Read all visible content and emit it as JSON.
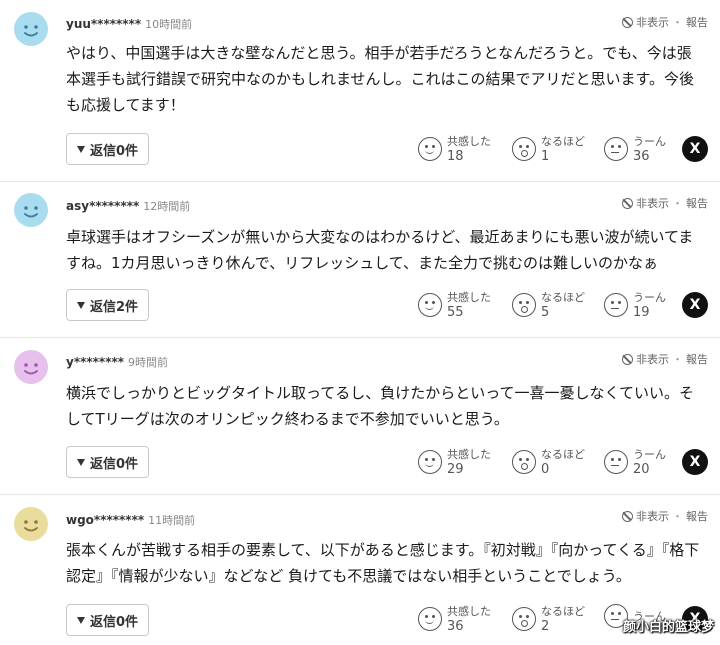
{
  "options": {
    "hide": "非表示",
    "sep": "・",
    "report": "報告"
  },
  "reactions": {
    "agree": "共感した",
    "insight": "なるほど",
    "hmm": "うーん"
  },
  "share_label": "X",
  "colors": {
    "avatar_blue": "#a9dcef",
    "avatar_pink": "#e8c0ee",
    "avatar_yellow": "#e9dc9c"
  },
  "comments": [
    {
      "user": "yuu********",
      "time": "10時間前",
      "body": "やはり、中国選手は大きな壁なんだと思う。相手が若手だろうとなんだろうと。でも、今は張本選手も試行錯誤で研究中なのかもしれませんし。これはこの結果でアリだと思います。今後も応援してます！",
      "reply_label": "返信0件",
      "agree": "18",
      "insight": "1",
      "hmm": "36"
    },
    {
      "user": "asy********",
      "time": "12時間前",
      "body": "卓球選手はオフシーズンが無いから大変なのはわかるけど、最近あまりにも悪い波が続いてますね。1カ月思いっきり休んで、リフレッシュして、また全力で挑むのは難しいのかなぁ",
      "reply_label": "返信2件",
      "agree": "55",
      "insight": "5",
      "hmm": "19"
    },
    {
      "user": "y********",
      "time": "9時間前",
      "body": "横浜でしっかりとビッグタイトル取ってるし、負けたからといって一喜一憂しなくていい。そしてTリーグは次のオリンピック終わるまで不参加でいいと思う。",
      "reply_label": "返信0件",
      "agree": "29",
      "insight": "0",
      "hmm": "20"
    },
    {
      "user": "wgo********",
      "time": "11時間前",
      "body": "張本くんが苦戦する相手の要素して、以下があると感じます。『初対戦』『向かってくる』『格下認定』『情報が少ない』などなど 負けても不思議ではない相手ということでしょう。",
      "reply_label": "返信0件",
      "agree": "36",
      "insight": "2",
      "hmm": ""
    }
  ],
  "watermark": "颜小白的篮球梦"
}
